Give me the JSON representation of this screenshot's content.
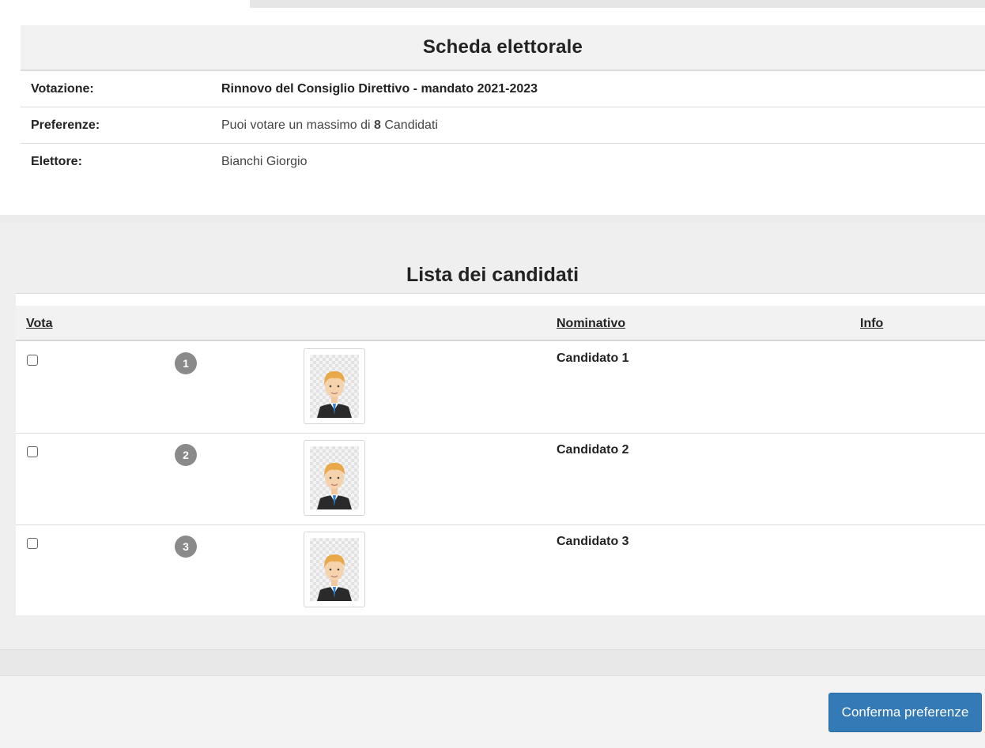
{
  "ballot": {
    "title": "Scheda elettorale",
    "vote_label": "Votazione:",
    "vote_value": "Rinnovo del Consiglio Direttivo - mandato 2021-2023",
    "pref_label": "Preferenze:",
    "pref_prefix": "Puoi votare un massimo di ",
    "pref_count": "8",
    "pref_suffix": " Candidati",
    "voter_label": "Elettore:",
    "voter_value": "Bianchi Giorgio"
  },
  "candidates": {
    "title": "Lista dei candidati",
    "headers": {
      "vote": "Vota",
      "name": "Nominativo",
      "info": "Info"
    },
    "rows": [
      {
        "number": "1",
        "name": "Candidato 1",
        "checked": false
      },
      {
        "number": "2",
        "name": "Candidato 2",
        "checked": false
      },
      {
        "number": "3",
        "name": "Candidato 3",
        "checked": false
      }
    ]
  },
  "footer": {
    "confirm_label": "Conferma preferenze"
  },
  "colors": {
    "primary": "#337ab7",
    "badge": "#8a8a8a"
  },
  "icons": {
    "avatar": "candidate-avatar-icon"
  }
}
